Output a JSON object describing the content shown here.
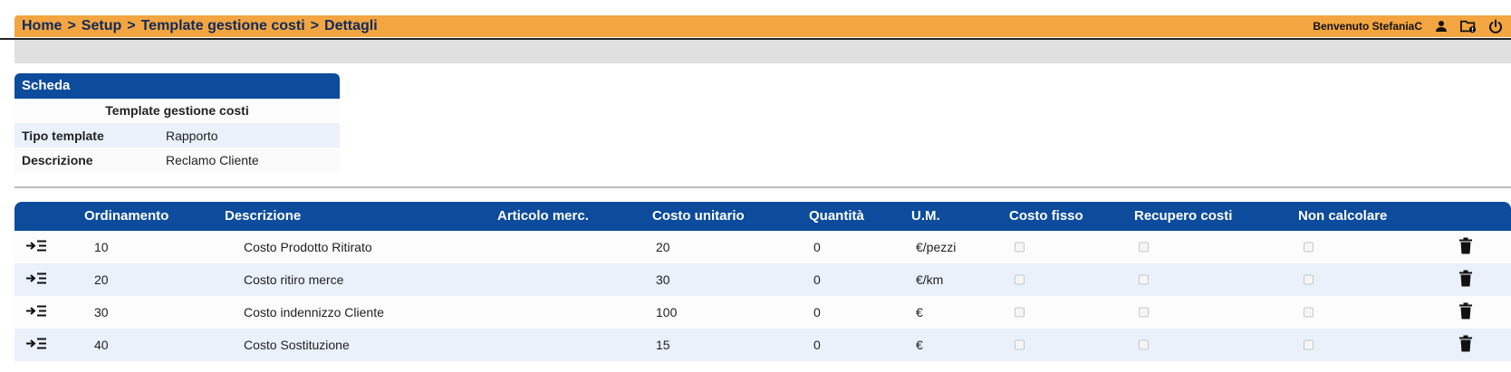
{
  "header": {
    "breadcrumb": [
      "Home",
      "Setup",
      "Template gestione costi",
      "Dettagli"
    ],
    "separator": ">",
    "welcome": "Benvenuto StefaniaC",
    "icons": [
      "user-icon",
      "folder-alert-icon",
      "power-icon"
    ],
    "accent_color": "#f2a541"
  },
  "card": {
    "title": "Scheda",
    "subtitle": "Template gestione costi",
    "rows": [
      {
        "label": "Tipo template",
        "value": "Rapporto"
      },
      {
        "label": "Descrizione",
        "value": "Reclamo Cliente"
      }
    ]
  },
  "table": {
    "headers": {
      "ordinamento": "Ordinamento",
      "descrizione": "Descrizione",
      "articolo": "Articolo merc.",
      "costo_unitario": "Costo unitario",
      "quantita": "Quantità",
      "um": "U.M.",
      "costo_fisso": "Costo fisso",
      "recupero_costi": "Recupero costi",
      "non_calcolare": "Non calcolare"
    },
    "rows": [
      {
        "ordinamento": "10",
        "descrizione": "Costo Prodotto Ritirato",
        "articolo": "",
        "costo_unitario": "20",
        "quantita": "0",
        "um": "€/pezzi",
        "costo_fisso": false,
        "recupero_costi": false,
        "non_calcolare": false
      },
      {
        "ordinamento": "20",
        "descrizione": "Costo ritiro merce",
        "articolo": "",
        "costo_unitario": "30",
        "quantita": "0",
        "um": "€/km",
        "costo_fisso": false,
        "recupero_costi": false,
        "non_calcolare": false
      },
      {
        "ordinamento": "30",
        "descrizione": "Costo indennizzo Cliente",
        "articolo": "",
        "costo_unitario": "100",
        "quantita": "0",
        "um": "€",
        "costo_fisso": false,
        "recupero_costi": false,
        "non_calcolare": false
      },
      {
        "ordinamento": "40",
        "descrizione": "Costo Sostituzione",
        "articolo": "",
        "costo_unitario": "15",
        "quantita": "0",
        "um": "€",
        "costo_fisso": false,
        "recupero_costi": false,
        "non_calcolare": false
      }
    ],
    "row_icons": [
      "detail-list-icon",
      "trash-icon"
    ],
    "header_color": "#0d4c9c"
  }
}
